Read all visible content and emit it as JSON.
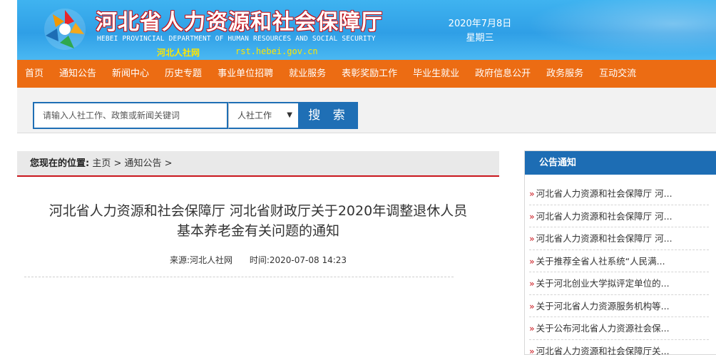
{
  "header": {
    "title": "河北省人力资源和社会保障厅",
    "subtitle": "HEBEI PROVINCIAL DEPARTMENT OF HUMAN RESOURCES AND SOCIAL SECURITY",
    "short_name": "河北人社网",
    "url": "rst.hebei.gov.cn",
    "date": "2020年7月8日",
    "weekday": "星期三"
  },
  "nav": {
    "items": [
      "首页",
      "通知公告",
      "新闻中心",
      "历史专题",
      "事业单位招聘",
      "就业服务",
      "表彰奖励工作",
      "毕业生就业",
      "政府信息公开",
      "政务服务",
      "互动交流"
    ]
  },
  "search": {
    "placeholder": "请输入人社工作、政策或新闻关键词",
    "select_value": "人社工作",
    "button_label": "搜 索"
  },
  "breadcrumb": {
    "label": "您现在的位置:",
    "home": "主页",
    "sep1": " > ",
    "current": "通知公告",
    "sep2": " >"
  },
  "article": {
    "title_line1": "河北省人力资源和社会保障厅 河北省财政厅关于2020年调整退休人员",
    "title_line2": "基本养老金有关问题的通知",
    "source": "来源:河北人社网",
    "time": "时间:2020-07-08 14:23"
  },
  "sidebar": {
    "heading": "公告通知",
    "items": [
      "河北省人力资源和社会保障厅 河...",
      "河北省人力资源和社会保障厅 河...",
      "河北省人力资源和社会保障厅 河...",
      "关于推荐全省人社系统“人民满...",
      "关于河北创业大学拟评定单位的...",
      "关于河北省人力资源服务机构等...",
      "关于公布河北省人力资源社会保...",
      "河北省人力资源和社会保障厅关..."
    ]
  },
  "colors": {
    "header_blue": "#2f9fe6",
    "nav_orange": "#ec6c13",
    "accent_blue": "#1f6fb5",
    "accent_red": "#c9161d"
  }
}
